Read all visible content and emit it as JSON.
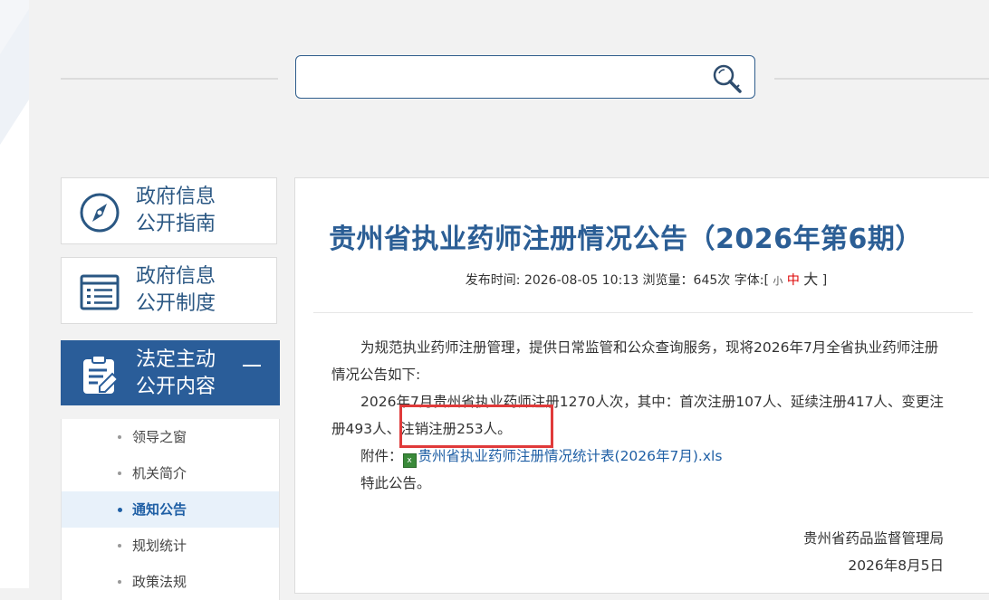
{
  "search": {
    "placeholder": ""
  },
  "nav": {
    "cards": [
      {
        "line1": "政府信息",
        "line2": "公开指南",
        "icon": "compass-icon"
      },
      {
        "line1": "政府信息",
        "line2": "公开制度",
        "icon": "list-icon"
      },
      {
        "line1": "法定主动",
        "line2": "公开内容",
        "icon": "clipboard-edit-icon"
      }
    ],
    "sub_items": [
      "领导之窗",
      "机关简介",
      "通知公告",
      "规划统计",
      "政策法规"
    ]
  },
  "article": {
    "title": "贵州省执业药师注册情况公告（2026年第6期）",
    "meta_prefix": "发布时间: 2026-08-05 10:13 浏览量：645次 字体:[",
    "font_small": "小",
    "font_medium": "中",
    "font_large": "大",
    "meta_suffix": "]",
    "p1": "为规范执业药师注册管理，提供日常监管和公众查询服务，现将2026年7月全省执业药师注册情况公告如下:",
    "p2": "2026年7月贵州省执业药师注册1270人次，其中：首次注册107人、延续注册417人、变更注册493人、注销注册253人。",
    "attach_label": "附件：",
    "attach_link": "贵州省执业药师注册情况统计表(2026年7月).xls",
    "closing": "特此公告。",
    "sign_org": "贵州省药品监督管理局",
    "sign_date": "2026年8月5日"
  },
  "colors": {
    "brand": "#2a5d99",
    "title": "#2b5e95",
    "highlight": "#e03a3a",
    "link": "#1f5fa5"
  }
}
